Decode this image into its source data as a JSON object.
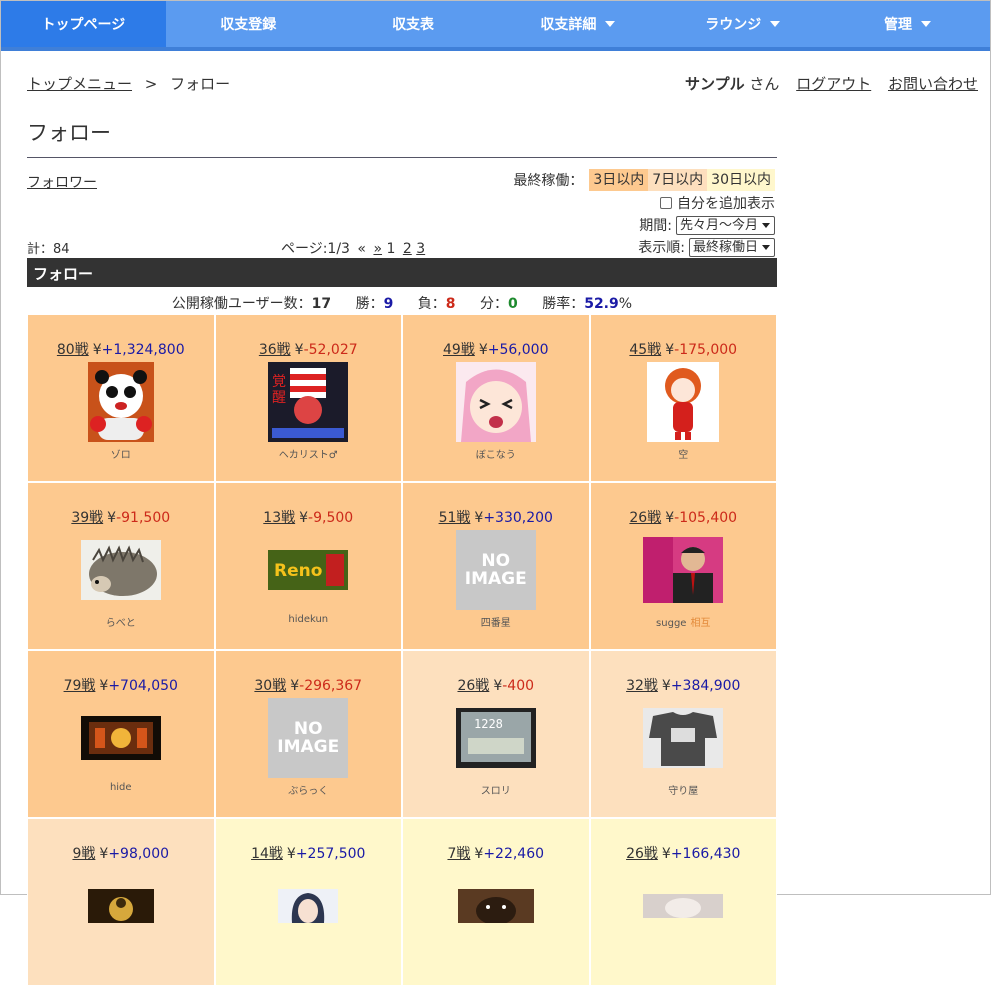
{
  "nav": [
    {
      "label": "トップページ",
      "caret": false,
      "active": true
    },
    {
      "label": "収支登録",
      "caret": false
    },
    {
      "label": "収支表",
      "caret": false
    },
    {
      "label": "収支詳細",
      "caret": true
    },
    {
      "label": "ラウンジ",
      "caret": true
    },
    {
      "label": "管理",
      "caret": true
    }
  ],
  "breadcrumb": {
    "parent": "トップメニュー",
    "sep": ">",
    "current": "フォロー"
  },
  "user": {
    "name": "サンプル",
    "suffix": "さん",
    "logout": "ログアウト",
    "contact": "お問い合わせ"
  },
  "page_title": "フォロー",
  "follower_link": "フォロワー",
  "last_operation": {
    "label": "最終稼働：",
    "options": [
      "3日以内",
      "7日以内",
      "30日以内"
    ]
  },
  "self_add_label": "自分を追加表示",
  "period": {
    "label": "期間:",
    "value": "先々月～今月"
  },
  "sort": {
    "label": "表示順:",
    "value": "最終稼働日"
  },
  "total": "計：84",
  "pager": {
    "label": "ページ:1/3",
    "prev": "«",
    "next": "»",
    "pages": [
      "1",
      "2",
      "3"
    ]
  },
  "section_title": "フォロー",
  "stats": {
    "users_label": "公開稼働ユーザー数：",
    "users": "17",
    "win_label": "勝：",
    "win": "9",
    "lose_label": "負：",
    "lose": "8",
    "draw_label": "分：",
    "draw": "0",
    "rate_label": "勝率：",
    "rate": "52.9",
    "rate_unit": "%"
  },
  "users": [
    {
      "games": "80戦",
      "yen": "¥",
      "amount": "+1,324,800",
      "name": "ゾロ",
      "bg": "c1",
      "img": "panda"
    },
    {
      "games": "36戦",
      "yen": "¥",
      "amount": "-52,027",
      "name": "ヘカリスト♂",
      "bg": "c1",
      "img": "juggler"
    },
    {
      "games": "49戦",
      "yen": "¥",
      "amount": "+56,000",
      "name": "ぼこなう",
      "bg": "c1",
      "img": "anime"
    },
    {
      "games": "45戦",
      "yen": "¥",
      "amount": "-175,000",
      "name": "空",
      "bg": "c1",
      "img": "asuka"
    },
    {
      "games": "39戦",
      "yen": "¥",
      "amount": "-91,500",
      "name": "らべと",
      "bg": "c1",
      "img": "hedgehog"
    },
    {
      "games": "13戦",
      "yen": "¥",
      "amount": "-9,500",
      "name": "hidekun",
      "bg": "c1",
      "img": "reno"
    },
    {
      "games": "51戦",
      "yen": "¥",
      "amount": "+330,200",
      "name": "四番星",
      "bg": "c1",
      "img": "noimage"
    },
    {
      "games": "26戦",
      "yen": "¥",
      "amount": "-105,400",
      "name": "sugge",
      "tag": "相互",
      "bg": "c1",
      "img": "man"
    },
    {
      "games": "79戦",
      "yen": "¥",
      "amount": "+704,050",
      "name": "hide",
      "bg": "c1",
      "img": "slot"
    },
    {
      "games": "30戦",
      "yen": "¥",
      "amount": "-296,367",
      "name": "ぶらっく",
      "bg": "c1",
      "img": "noimage"
    },
    {
      "games": "26戦",
      "yen": "¥",
      "amount": "-400",
      "name": "スロリ",
      "bg": "c2",
      "img": "screen"
    },
    {
      "games": "32戦",
      "yen": "¥",
      "amount": "+384,900",
      "name": "守り屋",
      "bg": "c2",
      "img": "shirt"
    },
    {
      "games": "9戦",
      "yen": "¥",
      "amount": "+98,000",
      "name": "",
      "bg": "c2",
      "img": "buddha"
    },
    {
      "games": "14戦",
      "yen": "¥",
      "amount": "+257,500",
      "name": "",
      "bg": "c3",
      "img": "animeboy"
    },
    {
      "games": "7戦",
      "yen": "¥",
      "amount": "+22,460",
      "name": "",
      "bg": "c3",
      "img": "dog"
    },
    {
      "games": "26戦",
      "yen": "¥",
      "amount": "+166,430",
      "name": "",
      "bg": "c3",
      "img": "cat"
    }
  ],
  "noimage_text": [
    "NO",
    "IMAGE"
  ],
  "colors": {
    "nav": "#5b9bf0",
    "nav_active": "#2d7be8",
    "positive": "#1a1aa6",
    "negative": "#cc2a1a"
  }
}
